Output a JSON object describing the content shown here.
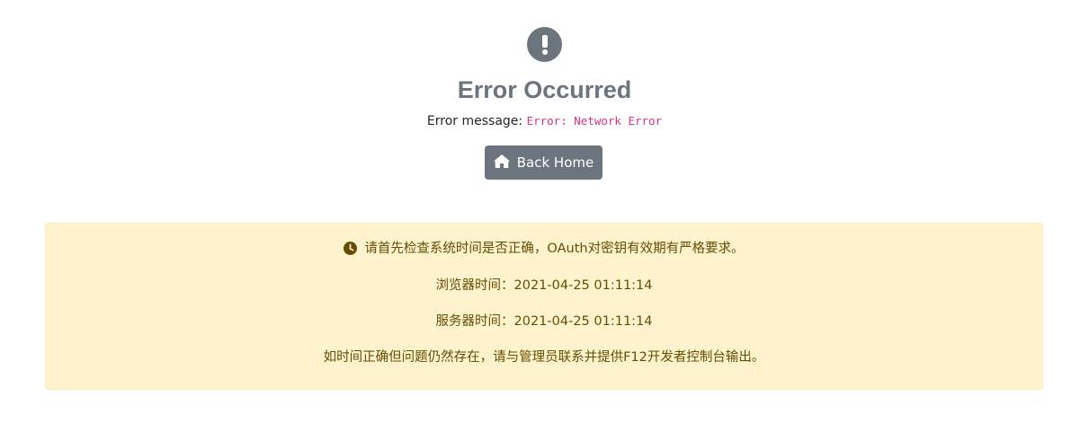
{
  "error": {
    "icon": "exclamation-circle-icon",
    "title": "Error Occurred",
    "message_label": "Error message:",
    "message_value": "Error: Network Error",
    "back_button_icon": "home-icon",
    "back_button_label": "Back Home"
  },
  "warning": {
    "icon": "clock-icon",
    "line1": "请首先检查系统时间是否正确，OAuth对密钥有效期有严格要求。",
    "browser_time_label": "浏览器时间：",
    "browser_time_value": "2021-04-25 01:11:14",
    "server_time_label": "服务器时间：",
    "server_time_value": "2021-04-25 01:11:14",
    "line4": "如时间正确但问题仍然存在，请与管理员联系并提供F12开发者控制台输出。"
  },
  "colors": {
    "secondary": "#6c757d",
    "warning_bg": "#fff3cd",
    "warning_text": "#664d03",
    "code": "#d63384"
  }
}
